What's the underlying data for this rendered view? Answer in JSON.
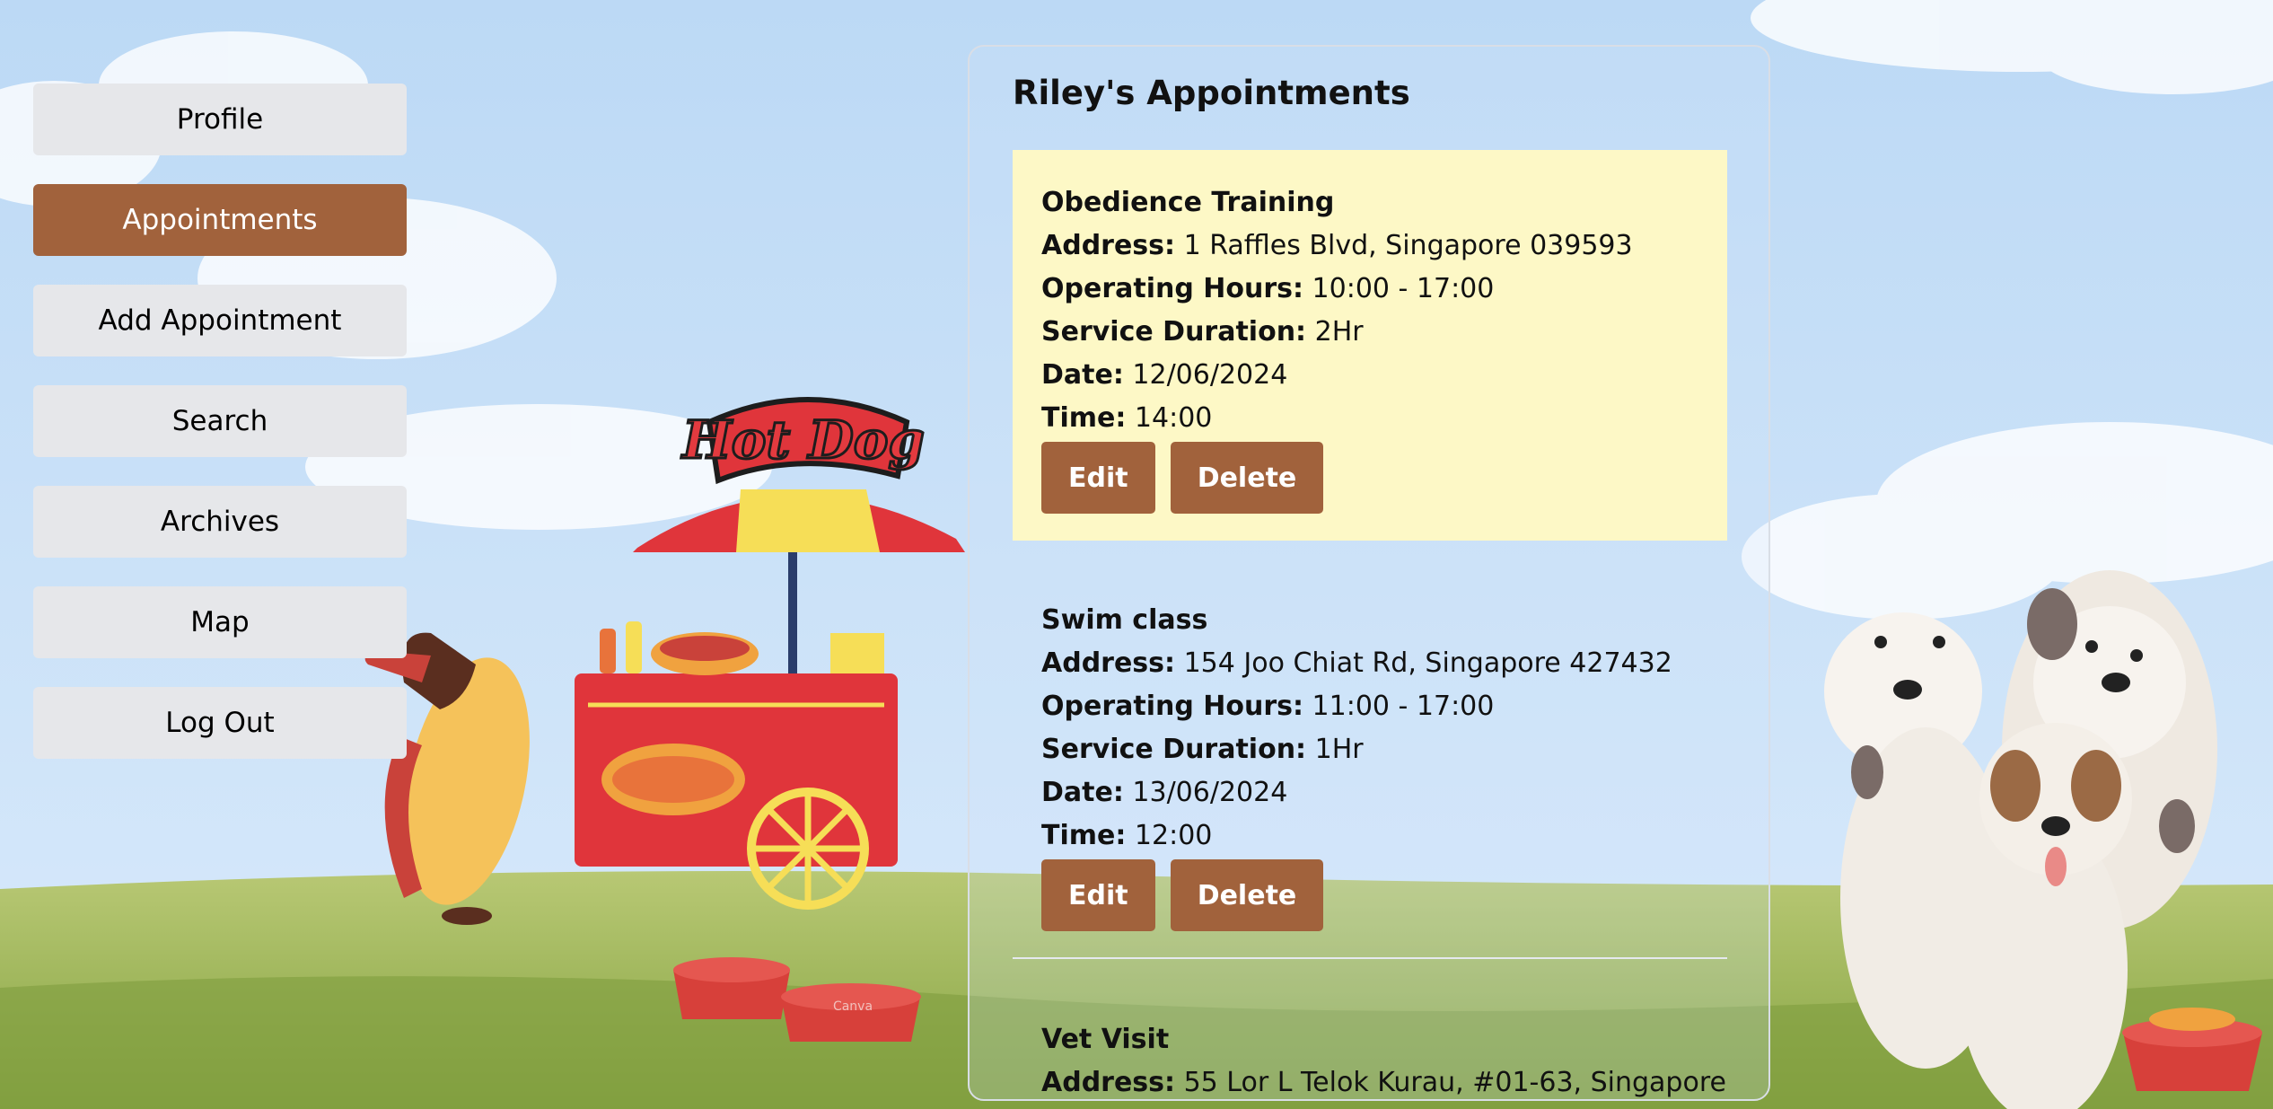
{
  "colors": {
    "accent": "#a1623c",
    "nav_bg": "#e6e7ea",
    "highlight": "#fdf8c6",
    "sky": "#cfe4fa",
    "grass": "#a9be5c"
  },
  "illustrations": {
    "hot_dog_sign": "Hot Dog",
    "bowl_label": "Canva"
  },
  "sidebar": {
    "items": [
      {
        "label": "Profile"
      },
      {
        "label": "Appointments"
      },
      {
        "label": "Add Appointment"
      },
      {
        "label": "Search"
      },
      {
        "label": "Archives"
      },
      {
        "label": "Map"
      },
      {
        "label": "Log Out"
      }
    ],
    "active_index": 1
  },
  "panel": {
    "title": "Riley's Appointments",
    "labels": {
      "address": "Address:",
      "hours": "Operating Hours:",
      "duration": "Service Duration:",
      "date": "Date:",
      "time": "Time:"
    },
    "edit_label": "Edit",
    "delete_label": "Delete",
    "appointments": [
      {
        "name": "Obedience Training",
        "address": "1 Raffles Blvd, Singapore 039593",
        "hours": "10:00 - 17:00",
        "duration": "2Hr",
        "date": "12/06/2024",
        "time": "14:00"
      },
      {
        "name": "Swim class",
        "address": "154 Joo Chiat Rd, Singapore 427432",
        "hours": "11:00 - 17:00",
        "duration": "1Hr",
        "date": "13/06/2024",
        "time": "12:00"
      },
      {
        "name": "Vet Visit",
        "address": "55 Lor L Telok Kurau, #01-63, Singapore"
      }
    ]
  }
}
